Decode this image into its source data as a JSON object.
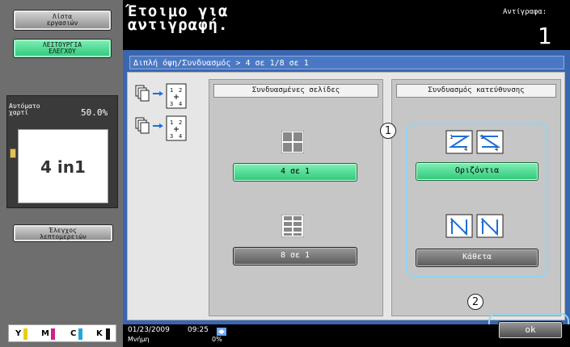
{
  "sidebar": {
    "job_list_label": "Λίστα\nεργασιών",
    "check_job_label": "ΛΕΙΤΟΥΡΓΙΑ\nΕΛΕΓΧΟΥ",
    "paper_label": "Αυτόματο\nχαρτί",
    "zoom_value": "50.0%",
    "preview_text": "4 in1",
    "check_details_label": "Έλεγχος\nλεπτομερειών",
    "toner": [
      {
        "label": "Y",
        "color": "#e8d000"
      },
      {
        "label": "M",
        "color": "#d0208a"
      },
      {
        "label": "C",
        "color": "#20a8d8"
      },
      {
        "label": "K",
        "color": "#111111"
      }
    ]
  },
  "header": {
    "title": "Έτοιμο για\nαντιγραφή.",
    "copies_label": "Αντίγραφα:",
    "copies_value": "1"
  },
  "breadcrumb": "Διπλή όψη/Συνδυασμός > 4 σε 1/8 σε 1",
  "combine_pages": {
    "title": "Συνδυασμένες σελίδες",
    "option_4in1": "4 σε 1",
    "option_8in1": "8 σε 1"
  },
  "combine_direction": {
    "title": "Συνδυασμός κατεύθυνσης",
    "horizontal_label": "Οριζόντια",
    "vertical_label": "Κάθετα"
  },
  "callouts": [
    "1",
    "2"
  ],
  "footer": {
    "date": "01/23/2009",
    "time": "09:25",
    "memory_label": "Μνήμη",
    "memory_value": "0%",
    "ok_label": "ok"
  },
  "colors": {
    "accent_green": "#3fd98a",
    "panel_blue": "#3a66b0",
    "callout_ring": "#8fd6f0"
  }
}
